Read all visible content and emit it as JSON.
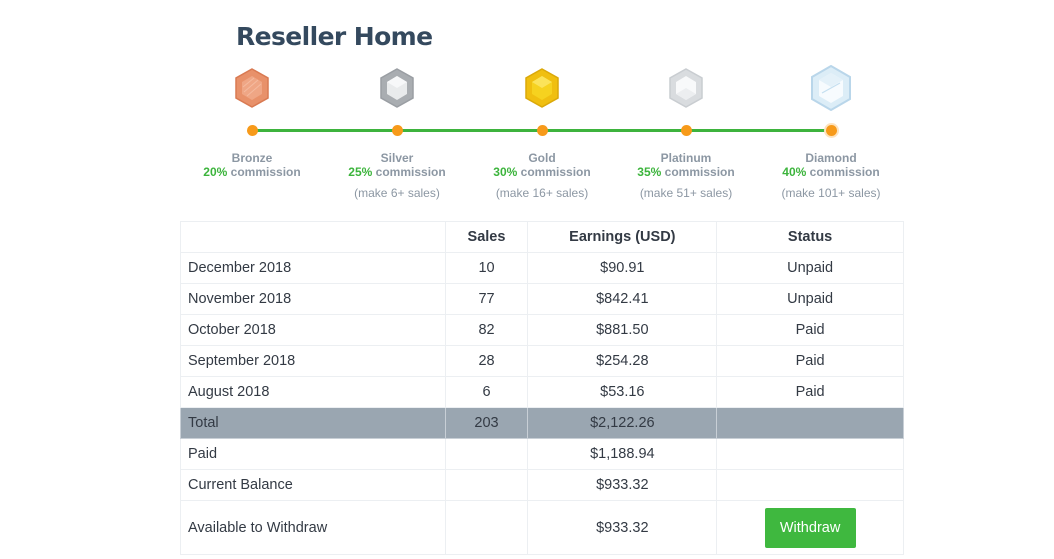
{
  "page": {
    "title": "Reseller Home"
  },
  "tiers": [
    {
      "name": "Bronze",
      "commission_pct": "20%",
      "commission_word": " commission",
      "requirement": "",
      "icon": "bronze-medal-icon",
      "color": "#e8916a"
    },
    {
      "name": "Silver",
      "commission_pct": "25%",
      "commission_word": " commission",
      "requirement": "(make 6+ sales)",
      "icon": "silver-medal-icon",
      "color": "#b9bcbf"
    },
    {
      "name": "Gold",
      "commission_pct": "30%",
      "commission_word": " commission",
      "requirement": "(make 16+ sales)",
      "icon": "gold-medal-icon",
      "color": "#f3c51b"
    },
    {
      "name": "Platinum",
      "commission_pct": "35%",
      "commission_word": " commission",
      "requirement": "(make 51+ sales)",
      "icon": "platinum-medal-icon",
      "color": "#e3e5e7"
    },
    {
      "name": "Diamond",
      "commission_pct": "40%",
      "commission_word": " commission",
      "requirement": "(make 101+ sales)",
      "icon": "diamond-medal-icon",
      "color": "#cfe5f3"
    }
  ],
  "table": {
    "headers": [
      "",
      "Sales",
      "Earnings (USD)",
      "Status"
    ],
    "months": [
      {
        "month": "December 2018",
        "sales": "10",
        "earnings": "$90.91",
        "status": "Unpaid"
      },
      {
        "month": "November 2018",
        "sales": "77",
        "earnings": "$842.41",
        "status": "Unpaid"
      },
      {
        "month": "October 2018",
        "sales": "82",
        "earnings": "$881.50",
        "status": "Paid"
      },
      {
        "month": "September 2018",
        "sales": "28",
        "earnings": "$254.28",
        "status": "Paid"
      },
      {
        "month": "August 2018",
        "sales": "6",
        "earnings": "$53.16",
        "status": "Paid"
      }
    ],
    "total": {
      "label": "Total",
      "sales": "203",
      "earnings": "$2,122.26"
    },
    "paid": {
      "label": "Paid",
      "earnings": "$1,188.94"
    },
    "balance": {
      "label": "Current Balance",
      "earnings": "$933.32"
    },
    "available": {
      "label": "Available to Withdraw",
      "earnings": "$933.32",
      "button_label": "Withdraw"
    }
  },
  "colors": {
    "accent_green": "#3fb83f",
    "timeline_dot": "#f79a1a",
    "total_row": "#9aa6b1"
  }
}
